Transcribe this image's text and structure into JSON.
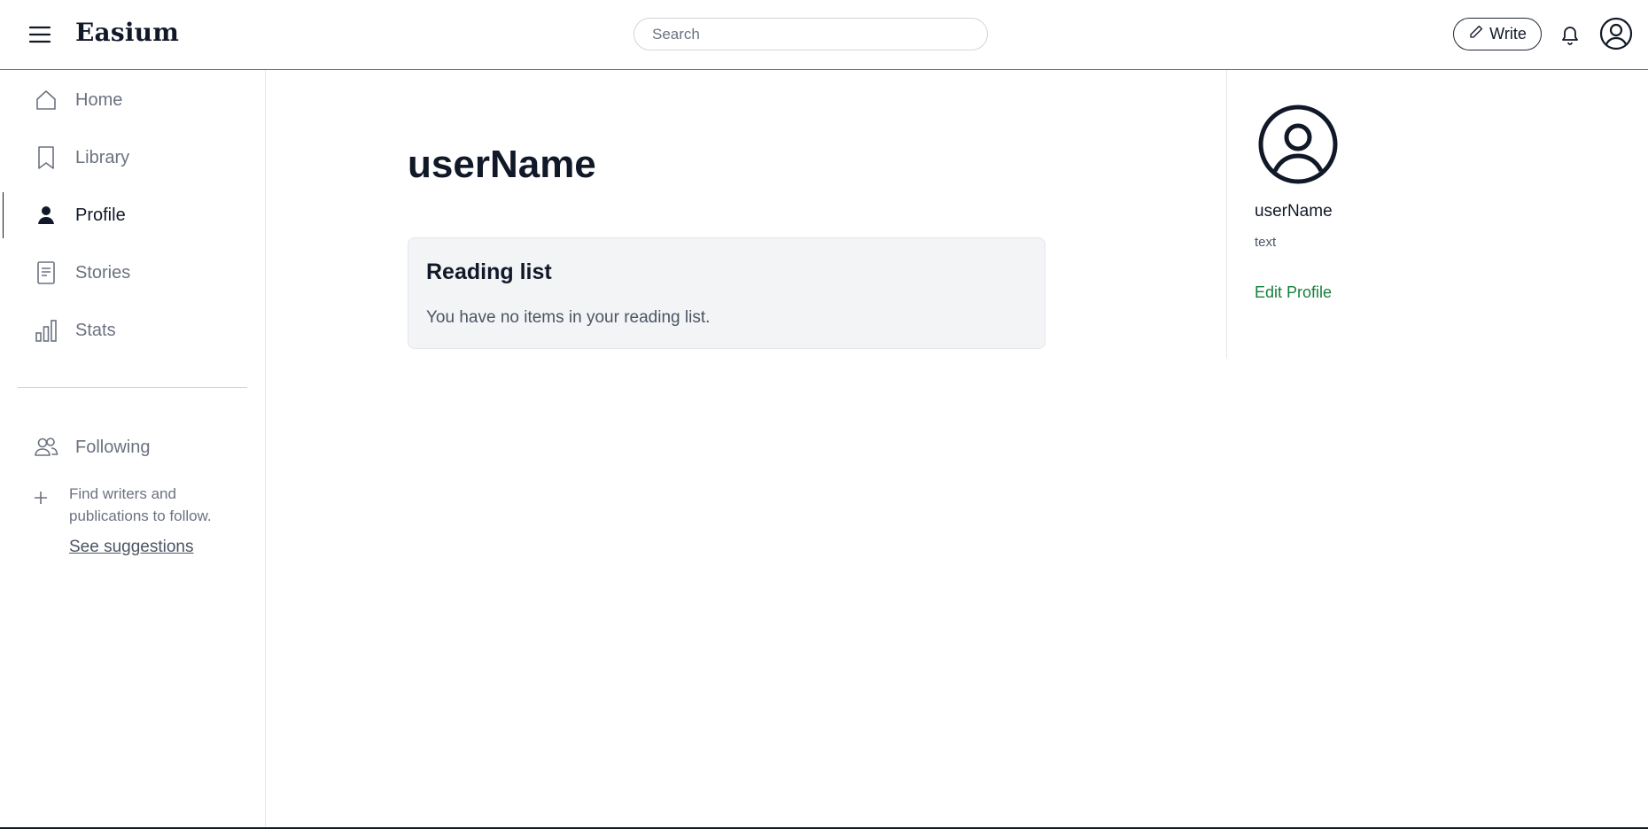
{
  "header": {
    "logo": "Easium",
    "search_placeholder": "Search",
    "write_label": "Write"
  },
  "sidebar": {
    "items": [
      {
        "label": "Home",
        "icon": "home-icon"
      },
      {
        "label": "Library",
        "icon": "bookmark-icon"
      },
      {
        "label": "Profile",
        "icon": "person-icon",
        "active": true
      },
      {
        "label": "Stories",
        "icon": "document-icon"
      },
      {
        "label": "Stats",
        "icon": "bar-chart-icon"
      }
    ],
    "following": {
      "label": "Following",
      "hint": "Find writers and publications to follow.",
      "suggestions": "See suggestions"
    }
  },
  "main": {
    "title": "userName",
    "reading_list": {
      "title": "Reading list",
      "empty_text": "You have no items in your reading list."
    }
  },
  "profile_panel": {
    "name": "userName",
    "bio": "text",
    "edit_label": "Edit Profile"
  },
  "colors": {
    "accent_green": "#15803d",
    "text_muted": "#6b7280",
    "card_bg": "#f3f4f6"
  }
}
